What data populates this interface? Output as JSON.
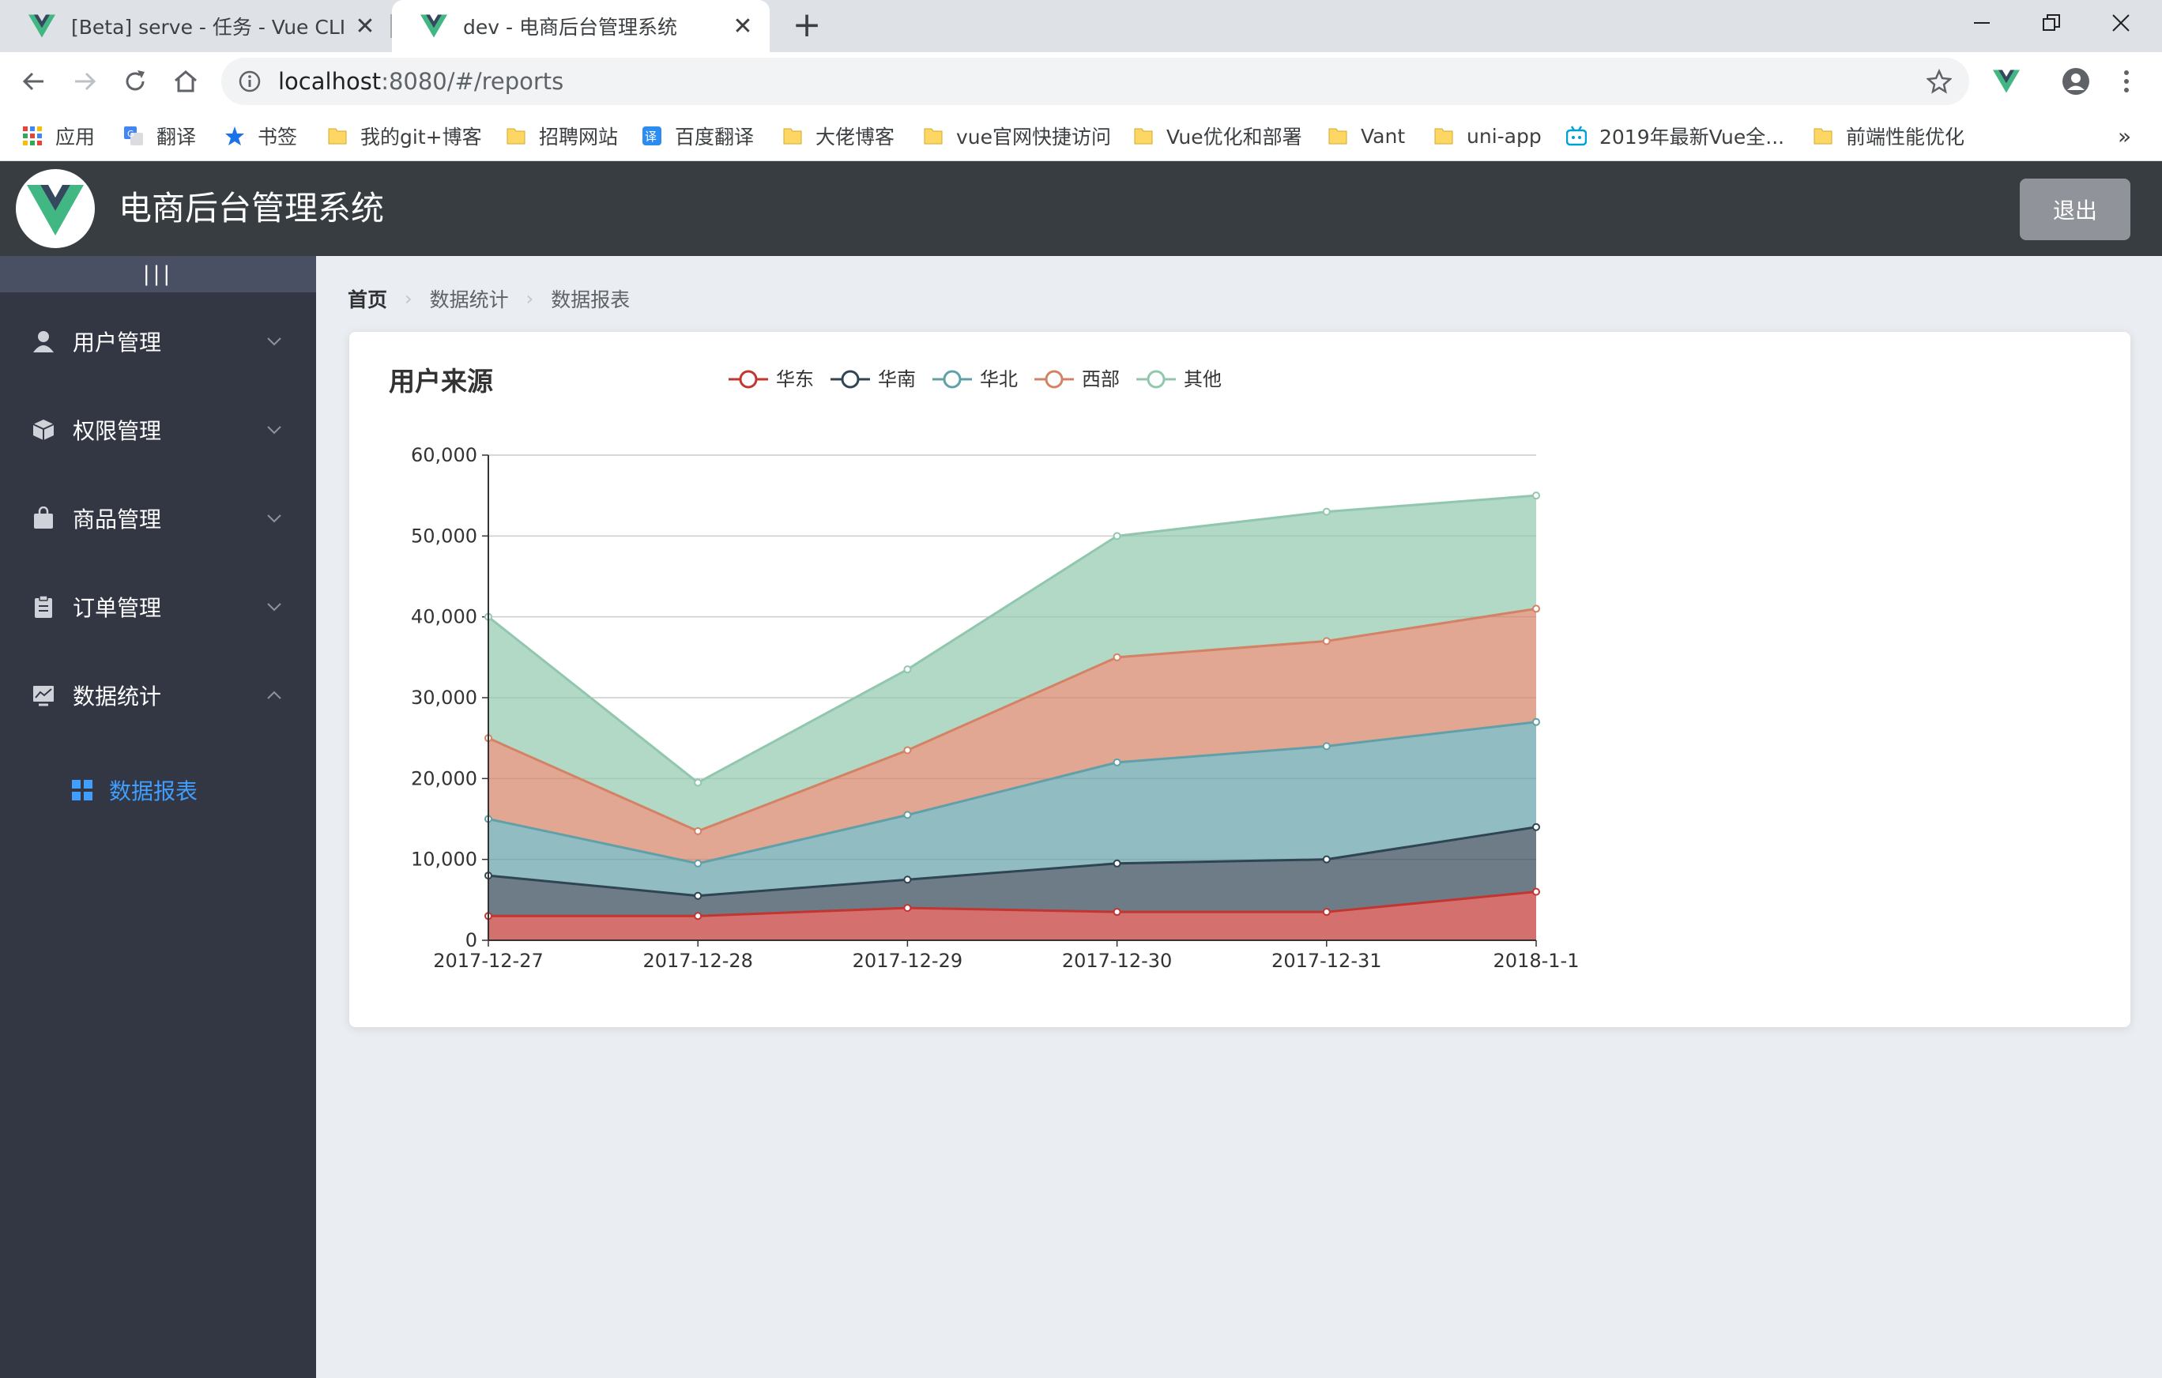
{
  "browser": {
    "tabs": [
      {
        "title": "[Beta] serve - 任务 - Vue CLI",
        "active": false
      },
      {
        "title": "dev - 电商后台管理系统",
        "active": true
      }
    ],
    "url": {
      "host": "localhost",
      "path": ":8080/#/reports"
    },
    "bookmarks": [
      {
        "label": "应用",
        "icon": "apps-grid-icon"
      },
      {
        "label": "翻译",
        "icon": "google-translate-icon"
      },
      {
        "label": "书签",
        "icon": "star-icon"
      },
      {
        "label": "我的git+博客",
        "icon": "folder-icon"
      },
      {
        "label": "招聘网站",
        "icon": "folder-icon"
      },
      {
        "label": "百度翻译",
        "icon": "baidu-translate-icon"
      },
      {
        "label": "大佬博客",
        "icon": "folder-icon"
      },
      {
        "label": "vue官网快捷访问",
        "icon": "folder-icon"
      },
      {
        "label": "Vue优化和部署",
        "icon": "folder-icon"
      },
      {
        "label": "Vant",
        "icon": "folder-icon"
      },
      {
        "label": "uni-app",
        "icon": "folder-icon"
      },
      {
        "label": "2019年最新Vue全...",
        "icon": "bilibili-icon"
      },
      {
        "label": "前端性能优化",
        "icon": "folder-icon"
      }
    ],
    "overflow": "»"
  },
  "header": {
    "title": "电商后台管理系统",
    "logout": "退出"
  },
  "sidebar": {
    "toggle": "|||",
    "items": [
      {
        "label": "用户管理",
        "icon": "user-icon",
        "expanded": false
      },
      {
        "label": "权限管理",
        "icon": "box-icon",
        "expanded": false
      },
      {
        "label": "商品管理",
        "icon": "shopping-bag-icon",
        "expanded": false
      },
      {
        "label": "订单管理",
        "icon": "clipboard-icon",
        "expanded": false
      },
      {
        "label": "数据统计",
        "icon": "chart-icon",
        "expanded": true
      }
    ],
    "sub_items": [
      {
        "label": "数据报表",
        "icon": "grid-icon",
        "active": true
      }
    ]
  },
  "breadcrumb": [
    "首页",
    "数据统计",
    "数据报表"
  ],
  "colors": {
    "accent": "#409eff",
    "header_bg": "#373d41",
    "sidebar_bg": "#333744"
  },
  "chart_data": {
    "type": "area",
    "stacked": true,
    "title": "用户来源",
    "categories": [
      "2017-12-27",
      "2017-12-28",
      "2017-12-29",
      "2017-12-30",
      "2017-12-31",
      "2018-1-1"
    ],
    "ylim": [
      0,
      60000
    ],
    "yticks": [
      0,
      10000,
      20000,
      30000,
      40000,
      50000,
      60000
    ],
    "ytick_labels": [
      "0",
      "10,000",
      "20,000",
      "30,000",
      "40,000",
      "50,000",
      "60,000"
    ],
    "grid": true,
    "legend_position": "top",
    "series": [
      {
        "name": "华东",
        "color": "#c23531",
        "values": [
          3000,
          3000,
          4000,
          3500,
          3500,
          6000
        ]
      },
      {
        "name": "华南",
        "color": "#2f4554",
        "values": [
          5000,
          2500,
          3500,
          6000,
          6500,
          8000
        ]
      },
      {
        "name": "华北",
        "color": "#61a0a8",
        "values": [
          7000,
          4000,
          8000,
          12500,
          14000,
          13000
        ]
      },
      {
        "name": "西部",
        "color": "#d48265",
        "values": [
          10000,
          4000,
          8000,
          13000,
          13000,
          14000
        ]
      },
      {
        "name": "其他",
        "color": "#91c7ae",
        "values": [
          15000,
          6000,
          10000,
          15000,
          16000,
          14000
        ]
      }
    ]
  }
}
